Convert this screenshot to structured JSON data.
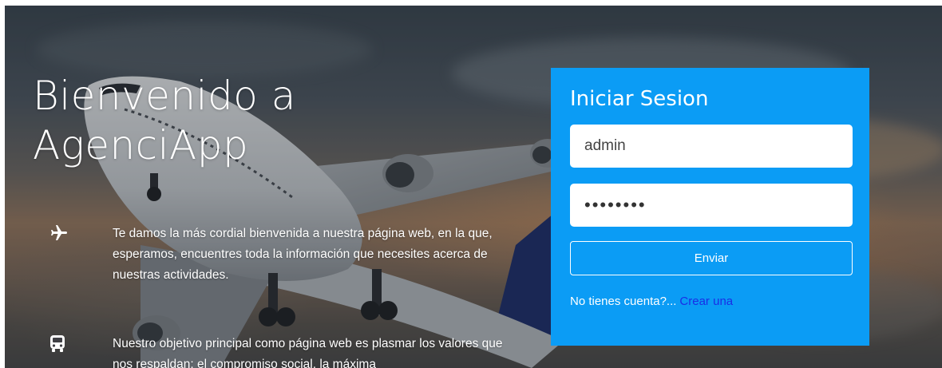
{
  "hero": {
    "title_line1": "Bienvenido a",
    "title_line2": "AgenciApp"
  },
  "features": [
    {
      "icon": "airplane-icon",
      "text": "Te damos la más cordial bienvenida a nuestra página web, en la que, esperamos, encuentres toda la información que necesites acerca de nuestras actividades."
    },
    {
      "icon": "bus-icon",
      "text": "Nuestro objetivo principal como página web es plasmar los valores que nos respaldan: el compromiso social, la máxima"
    }
  ],
  "login": {
    "title": "Iniciar Sesion",
    "username_value": "admin",
    "password_value": "••••••••",
    "submit_label": "Enviar",
    "signup_prompt": "No tienes cuenta?...",
    "signup_link": "Crear una"
  },
  "colors": {
    "panel": "#0b9cf5",
    "link": "#1a2ee6"
  }
}
